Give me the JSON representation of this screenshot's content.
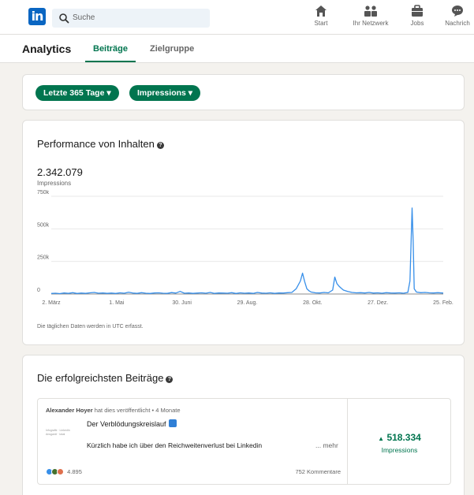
{
  "search": {
    "placeholder": "Suche"
  },
  "nav": [
    {
      "label": "Start",
      "icon": "home-icon"
    },
    {
      "label": "Ihr Netzwerk",
      "icon": "network-icon"
    },
    {
      "label": "Jobs",
      "icon": "briefcase-icon"
    },
    {
      "label": "Nachrich",
      "icon": "message-icon"
    }
  ],
  "subnav": {
    "title": "Analytics",
    "tabs": [
      "Beiträge",
      "Zielgruppe"
    ],
    "active_tab": "Beiträge"
  },
  "filters": {
    "range": "Letzte 365 Tage",
    "metric": "Impressions"
  },
  "performance": {
    "title": "Performance von Inhalten",
    "total": "2.342.079",
    "total_label": "Impressions",
    "note": "Die täglichen Daten werden in UTC erfasst."
  },
  "chart_data": {
    "type": "line",
    "title": "",
    "x_ticks": [
      "2. März",
      "1. Mai",
      "30. Juni",
      "29. Aug.",
      "28. Okt.",
      "27. Dez.",
      "25. Feb."
    ],
    "y_ticks": [
      "0",
      "250k",
      "500k",
      "750k"
    ],
    "ylim": [
      0,
      750000
    ],
    "series": [
      {
        "x": [
          0,
          4,
          8,
          12,
          16,
          20,
          24,
          28,
          32,
          36,
          40,
          44,
          48,
          52,
          56,
          60,
          64,
          68,
          72,
          76,
          80,
          84,
          88,
          92,
          96,
          100,
          104,
          108,
          112,
          116,
          120,
          124,
          128,
          132,
          136,
          140,
          144,
          148,
          152,
          156,
          160,
          164,
          168,
          172,
          176,
          180,
          184,
          188,
          192,
          196,
          200,
          204,
          208,
          212,
          216,
          220,
          224,
          228,
          232,
          234,
          236,
          238,
          240,
          242,
          246,
          250,
          254,
          258,
          262,
          264,
          266,
          268,
          270,
          272,
          276,
          280,
          284,
          288,
          292,
          296,
          300,
          304,
          308,
          312,
          316,
          320,
          324,
          328,
          332,
          334,
          336,
          337,
          338,
          340,
          344,
          348,
          352,
          356,
          360,
          365
        ],
        "y": [
          4000,
          6000,
          3000,
          8000,
          5000,
          10000,
          4000,
          7000,
          5000,
          9000,
          12000,
          6000,
          8000,
          5000,
          7000,
          4000,
          9000,
          6000,
          14000,
          7000,
          5000,
          10000,
          6000,
          4000,
          8000,
          9000,
          6000,
          5000,
          11000,
          7000,
          20000,
          6000,
          8000,
          5000,
          7000,
          9000,
          6000,
          12000,
          5000,
          8000,
          7000,
          6000,
          10000,
          4000,
          9000,
          6000,
          8000,
          5000,
          12000,
          7000,
          6000,
          9000,
          5000,
          8000,
          7000,
          10000,
          12000,
          40000,
          100000,
          160000,
          95000,
          40000,
          25000,
          15000,
          9000,
          8000,
          12000,
          9000,
          30000,
          130000,
          80000,
          60000,
          45000,
          30000,
          20000,
          12000,
          9000,
          10000,
          8000,
          12000,
          7000,
          9000,
          6000,
          10000,
          8000,
          7000,
          9000,
          6000,
          12000,
          100000,
          660000,
          400000,
          40000,
          15000,
          10000,
          12000,
          9000,
          8000,
          10000,
          7000
        ]
      }
    ]
  },
  "top_posts": {
    "title": "Die erfolgreichsten Beiträge",
    "post": {
      "author": "Alexander Hoyer",
      "meta": "hat dies veröffentlicht • 4 Monate",
      "title": "Der Verblödungskreislauf",
      "thumb_text": "Infografik · LinkedIn Ansgardt · lokal",
      "text": "Kürzlich habe ich über den Reichweitenverlust bei Linkedin",
      "more": "... mehr",
      "reactions": "4.895",
      "comments": "752 Kommentare",
      "impressions": "518.334",
      "impressions_label": "Impressions"
    }
  },
  "colors": {
    "brand": "#0a66c2",
    "accent": "#01754f",
    "line": "#378fe9"
  }
}
